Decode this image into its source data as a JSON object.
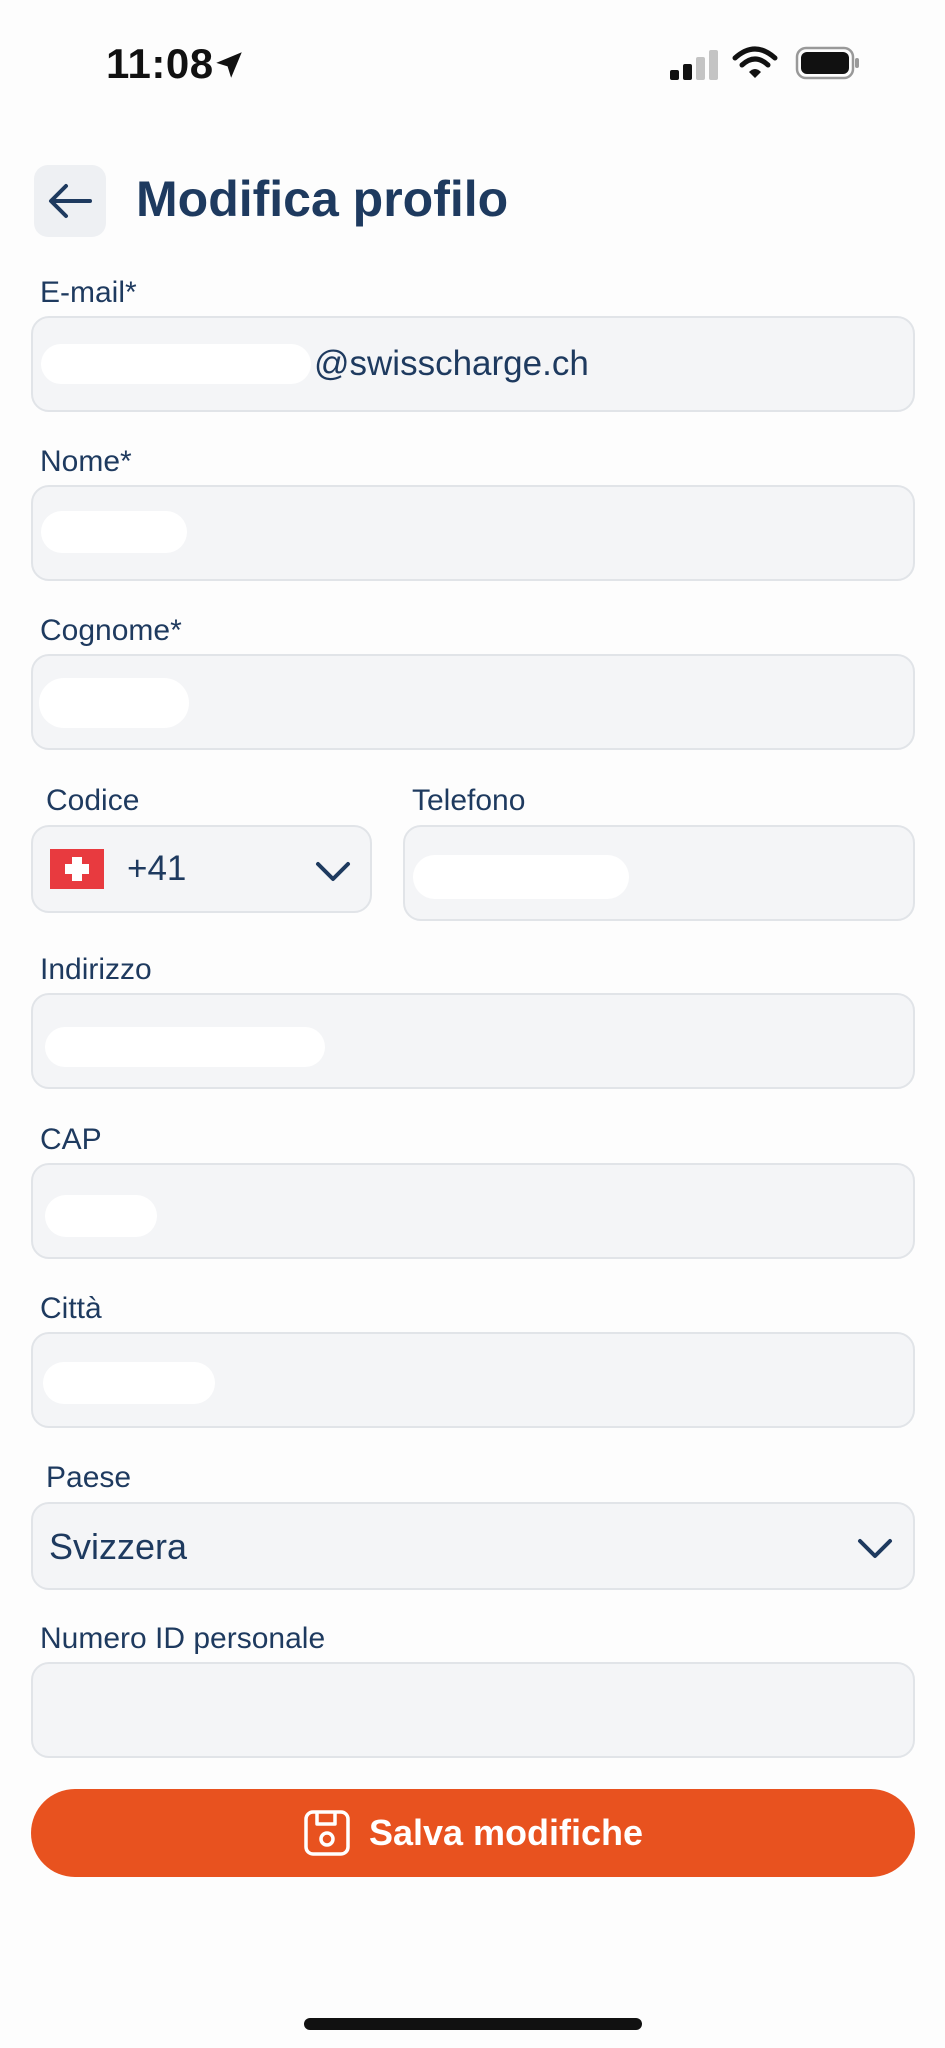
{
  "status_bar": {
    "time": "11:08"
  },
  "header": {
    "title": "Modifica profilo"
  },
  "form": {
    "email": {
      "label": "E-mail*",
      "value_visible": "@swisscharge.ch"
    },
    "nome": {
      "label": "Nome*"
    },
    "cognome": {
      "label": "Cognome*"
    },
    "codice": {
      "label": "Codice",
      "value": "+41"
    },
    "telefono": {
      "label": "Telefono"
    },
    "indirizzo": {
      "label": "Indirizzo"
    },
    "cap": {
      "label": "CAP"
    },
    "citta": {
      "label": "Città"
    },
    "paese": {
      "label": "Paese",
      "value": "Svizzera"
    },
    "numero_id": {
      "label": "Numero ID personale",
      "value": ""
    }
  },
  "actions": {
    "save_label": "Salva modifiche"
  },
  "colors": {
    "primary": "#1e3a5f",
    "accent": "#e8521f",
    "field_bg": "#f4f5f7",
    "flag_red": "#e83a3f"
  },
  "icons": [
    "location-arrow-icon",
    "signal-icon",
    "wifi-icon",
    "battery-icon",
    "back-arrow-icon",
    "swiss-flag-icon",
    "chevron-down-icon",
    "floppy-disk-icon"
  ]
}
